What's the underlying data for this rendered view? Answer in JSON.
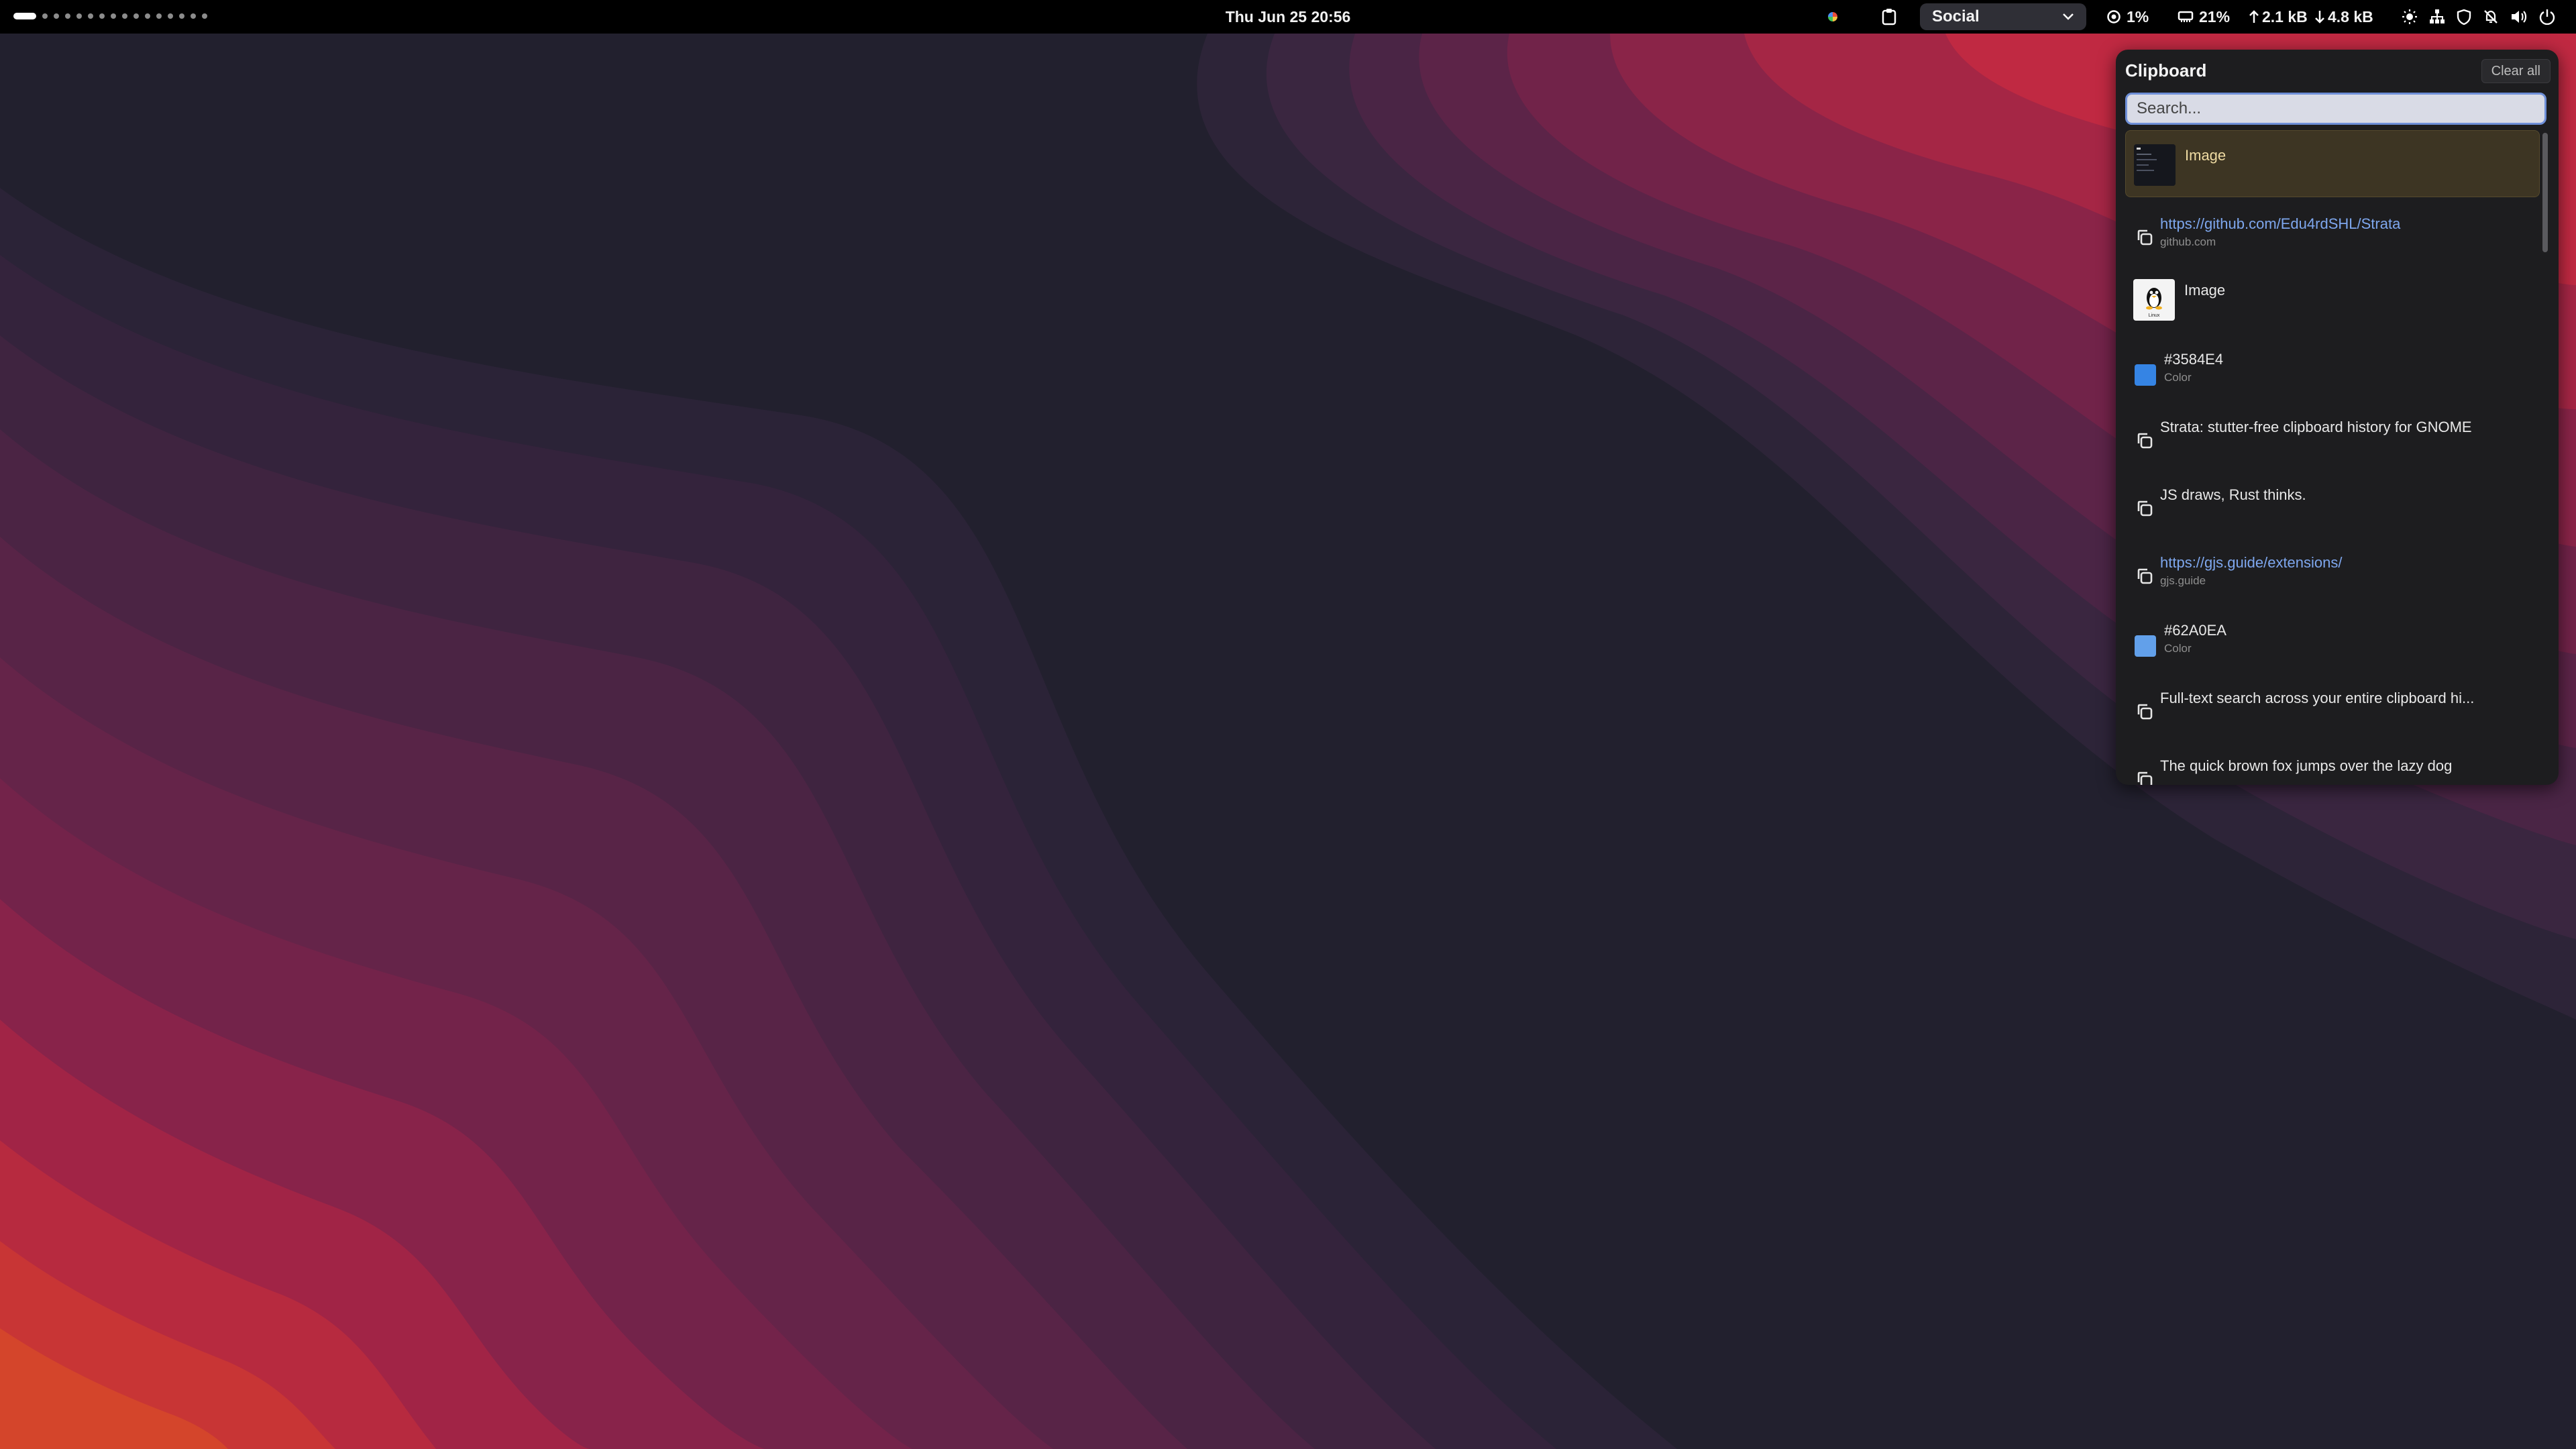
{
  "topbar": {
    "workspaces": {
      "count": 16,
      "active_index": 0
    },
    "clock": "Thu Jun 25  20:56",
    "profile": {
      "selected": "Social"
    },
    "stats": {
      "cpu": "1%",
      "memory": "21%",
      "upload": "2.1 kB",
      "download": "4.8 kB"
    }
  },
  "clipboard": {
    "title": "Clipboard",
    "clear_label": "Clear all",
    "search_placeholder": "Search...",
    "items": [
      {
        "type": "image",
        "title": "Image",
        "selected": true,
        "thumb": "terminal-screenshot"
      },
      {
        "type": "link",
        "title": "https://github.com/Edu4rdSHL/Strata",
        "sub": "github.com"
      },
      {
        "type": "image",
        "title": "Image",
        "thumb": "linux-tux"
      },
      {
        "type": "color",
        "title": "#3584E4",
        "sub": "Color",
        "color": "#3584E4"
      },
      {
        "type": "text",
        "title": "Strata: stutter-free clipboard history for GNOME"
      },
      {
        "type": "text",
        "title": "JS draws, Rust thinks."
      },
      {
        "type": "link",
        "title": "https://gjs.guide/extensions/",
        "sub": "gjs.guide"
      },
      {
        "type": "color",
        "title": "#62A0EA",
        "sub": "Color",
        "color": "#62A0EA"
      },
      {
        "type": "text",
        "title": "Full-text search across your entire clipboard hi..."
      },
      {
        "type": "text",
        "title": "The quick brown fox jumps over the lazy dog"
      }
    ]
  },
  "thumb_labels": {
    "tux": "Linux"
  }
}
